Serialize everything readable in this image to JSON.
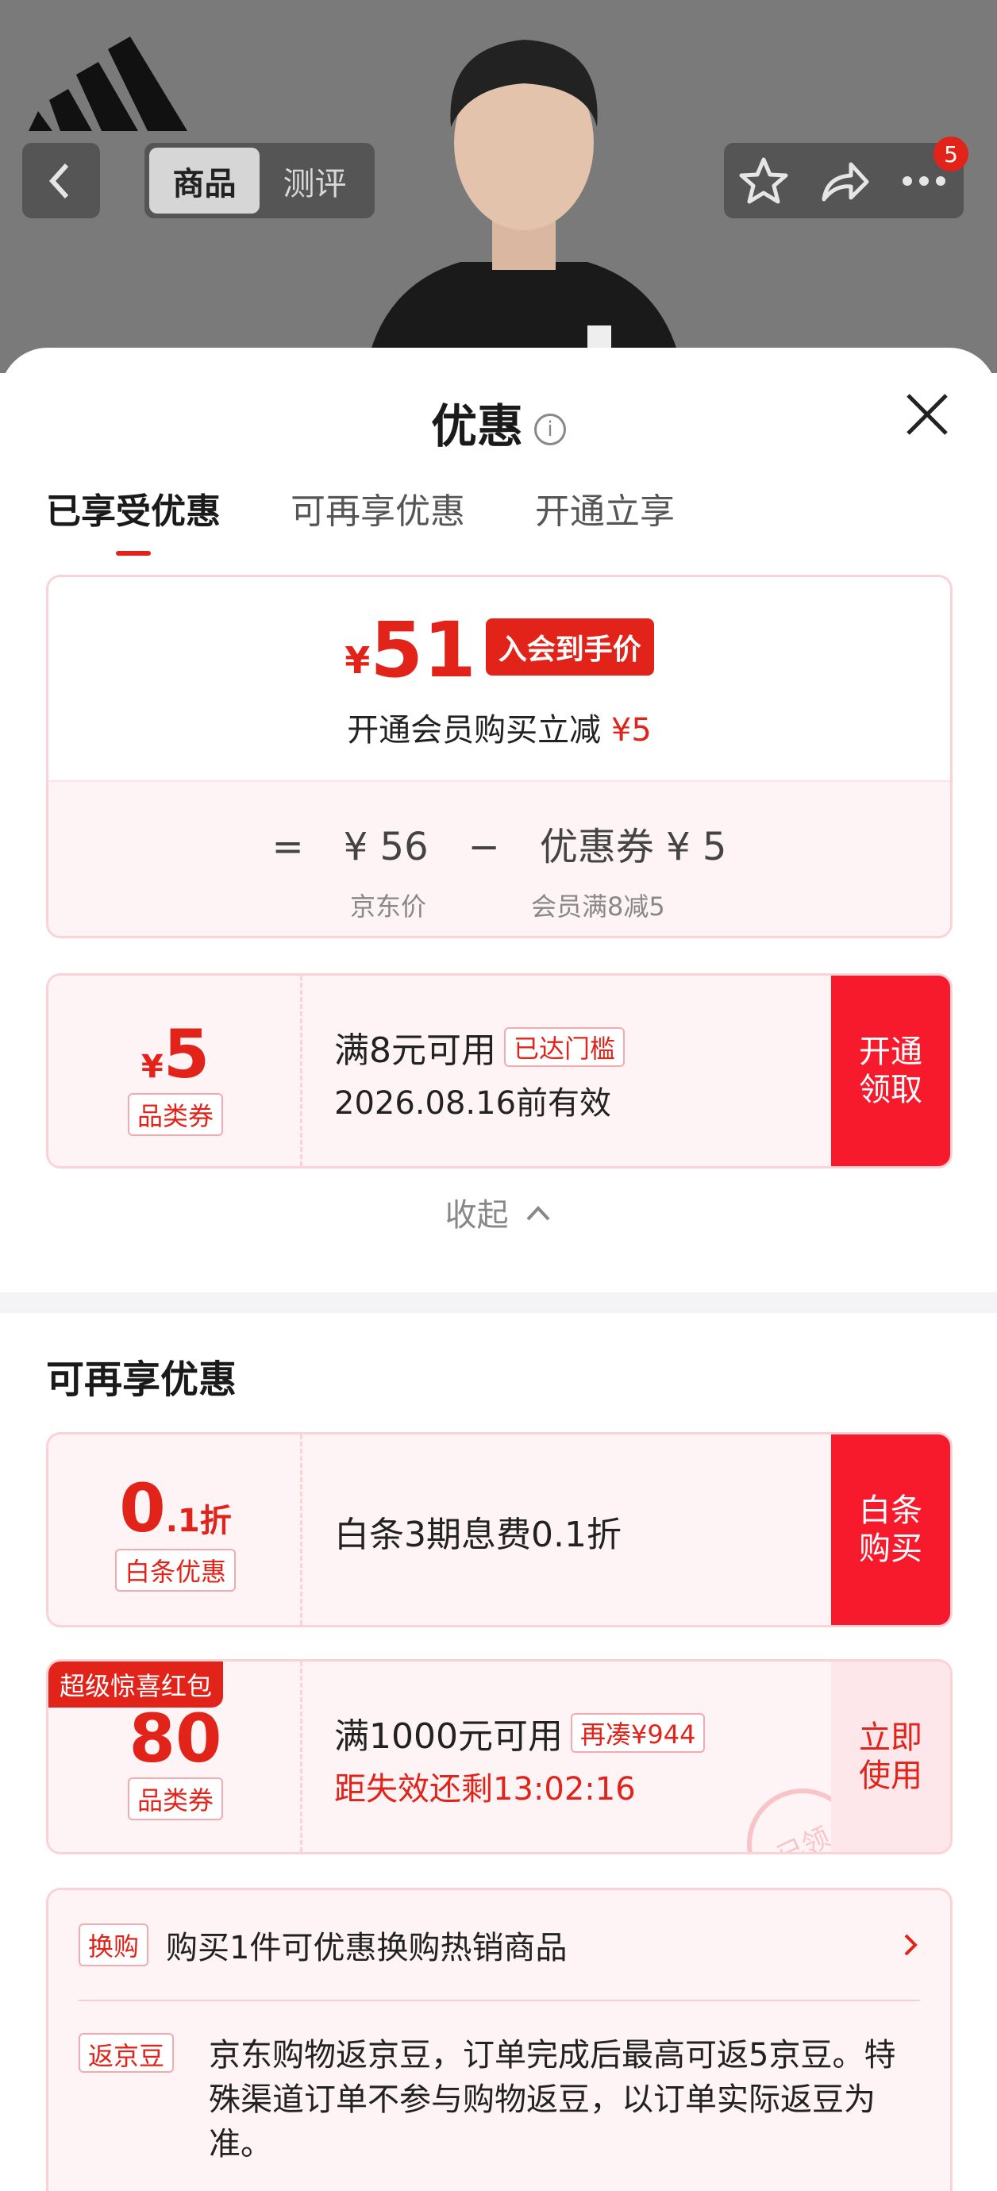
{
  "nav": {
    "tab_goods": "商品",
    "tab_review": "测评",
    "badge_count": "5"
  },
  "sheet": {
    "title": "优惠",
    "tabs": [
      "已享受优惠",
      "可再享优惠",
      "开通立享"
    ],
    "price": {
      "currency": "¥",
      "value": "51",
      "tag": "入会到手价",
      "sub_text": "开通会员购买立减",
      "sub_amount": "¥5",
      "eq": "=",
      "jd_price": "¥ 56",
      "minus": "−",
      "coupon_formula": "优惠券 ¥ 5",
      "jd_price_label": "京东价",
      "coupon_label": "会员满8减5"
    },
    "coupon1": {
      "currency": "¥",
      "amount": "5",
      "kind": "品类券",
      "condition": "满8元可用",
      "status": "已达门槛",
      "valid": "2026.08.16前有效",
      "cta": "开通领取"
    },
    "collapse": "收起",
    "section2_title": "可再享优惠",
    "coupon2": {
      "amount": "0",
      "unit": ".1折",
      "kind": "白条优惠",
      "desc": "白条3期息费0.1折",
      "cta": "白条购买"
    },
    "coupon3": {
      "ribbon": "超级惊喜红包",
      "amount": "80",
      "kind": "品类券",
      "condition": "满1000元可用",
      "pill": "再凑¥944",
      "countdown": "距失效还剩13:02:16",
      "cta": "立即使用",
      "stamp": "已领"
    },
    "misc": {
      "chip1": "换购",
      "text1": "购买1件可优惠换购热销商品",
      "chip2": "返京豆",
      "text2": "京东购物返京豆，订单完成后最高可返5京豆。特殊渠道订单不参与购物返豆，以订单实际返豆为准。"
    }
  },
  "colors": {
    "accent": "#e2231a",
    "cta": "#f61a2c",
    "card_bg": "#fff4f5"
  }
}
